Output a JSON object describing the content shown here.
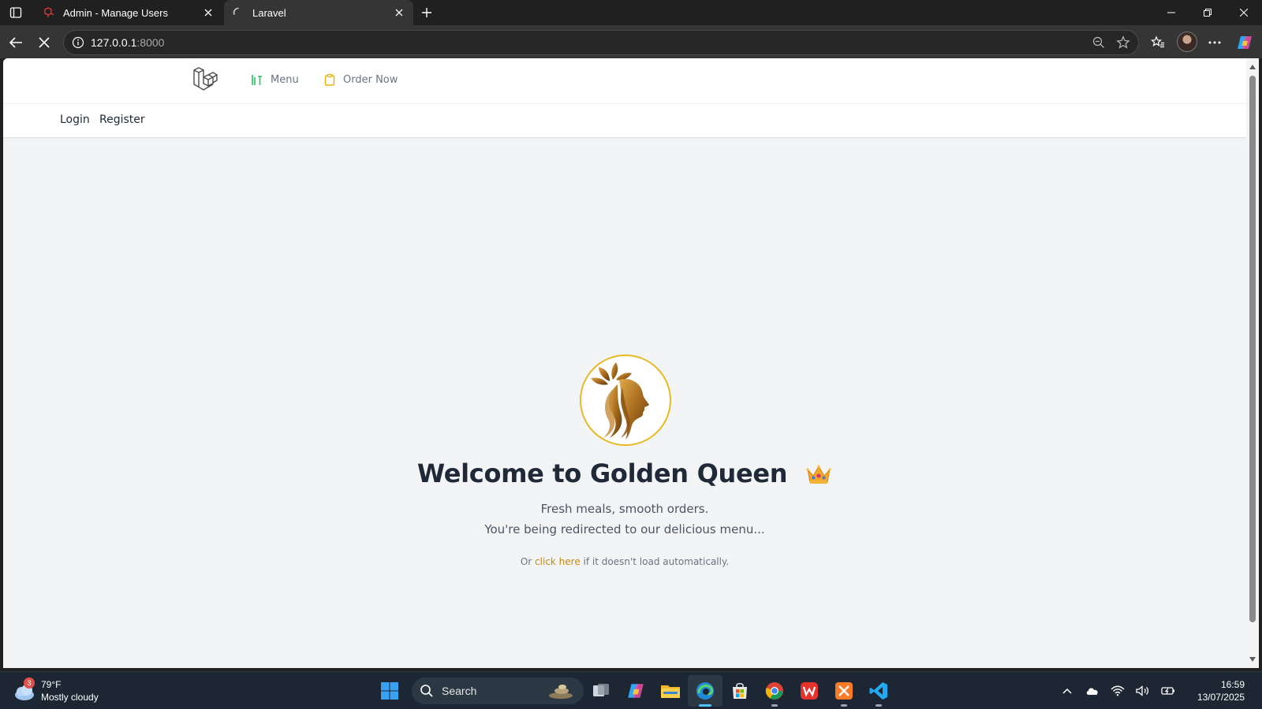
{
  "browser": {
    "tabs": [
      {
        "title": "Admin - Manage Users",
        "state": "inactive"
      },
      {
        "title": "Laravel",
        "state": "active-loading"
      }
    ],
    "address": {
      "host": "127.0.0.1",
      "port": ":8000"
    }
  },
  "site": {
    "nav": {
      "menu_label": "Menu",
      "order_label": "Order Now",
      "menu_icon": "bar-chart-icon",
      "order_icon": "clipboard-icon",
      "accent_green": "#22c55e",
      "accent_yellow": "#eab308"
    },
    "auth": {
      "login": "Login",
      "register": "Register"
    },
    "hero": {
      "title": "Welcome to Golden Queen",
      "tagline": "Fresh meals, smooth orders.",
      "redirect": "You're being redirected to our delicious menu...",
      "fallback_prefix": "Or",
      "fallback_link": "click here",
      "fallback_suffix": "if it doesn't load automatically.",
      "brand_gold": "#e7b923",
      "link_color": "#c8870d"
    }
  },
  "taskbar": {
    "weather": {
      "temp": "79°F",
      "condition": "Mostly cloudy",
      "badge": "3"
    },
    "search_label": "Search",
    "time": "16:59",
    "date": "13/07/2025"
  }
}
